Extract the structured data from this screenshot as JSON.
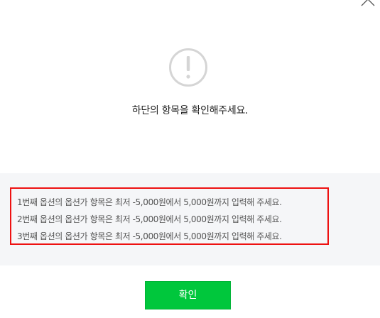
{
  "dialog": {
    "heading": "하단의 항목을 확인해주세요.",
    "close_icon": "close-icon",
    "alert_icon": "exclamation-circle-icon",
    "errors": [
      "1번째 옵션의 옵션가 항목은 최저 -5,000원에서 5,000원까지 입력해 주세요.",
      "2번째 옵션의 옵션가 항목은 최저 -5,000원에서 5,000원까지 입력해 주세요.",
      "3번째 옵션의 옵션가 항목은 최저 -5,000원에서 5,000원까지 입력해 주세요."
    ],
    "confirm_label": "확인"
  },
  "colors": {
    "confirm_button": "#00c73c",
    "error_border": "#ee1111",
    "panel_background": "#f5f6f8",
    "icon_gray": "#d5d5d5"
  }
}
